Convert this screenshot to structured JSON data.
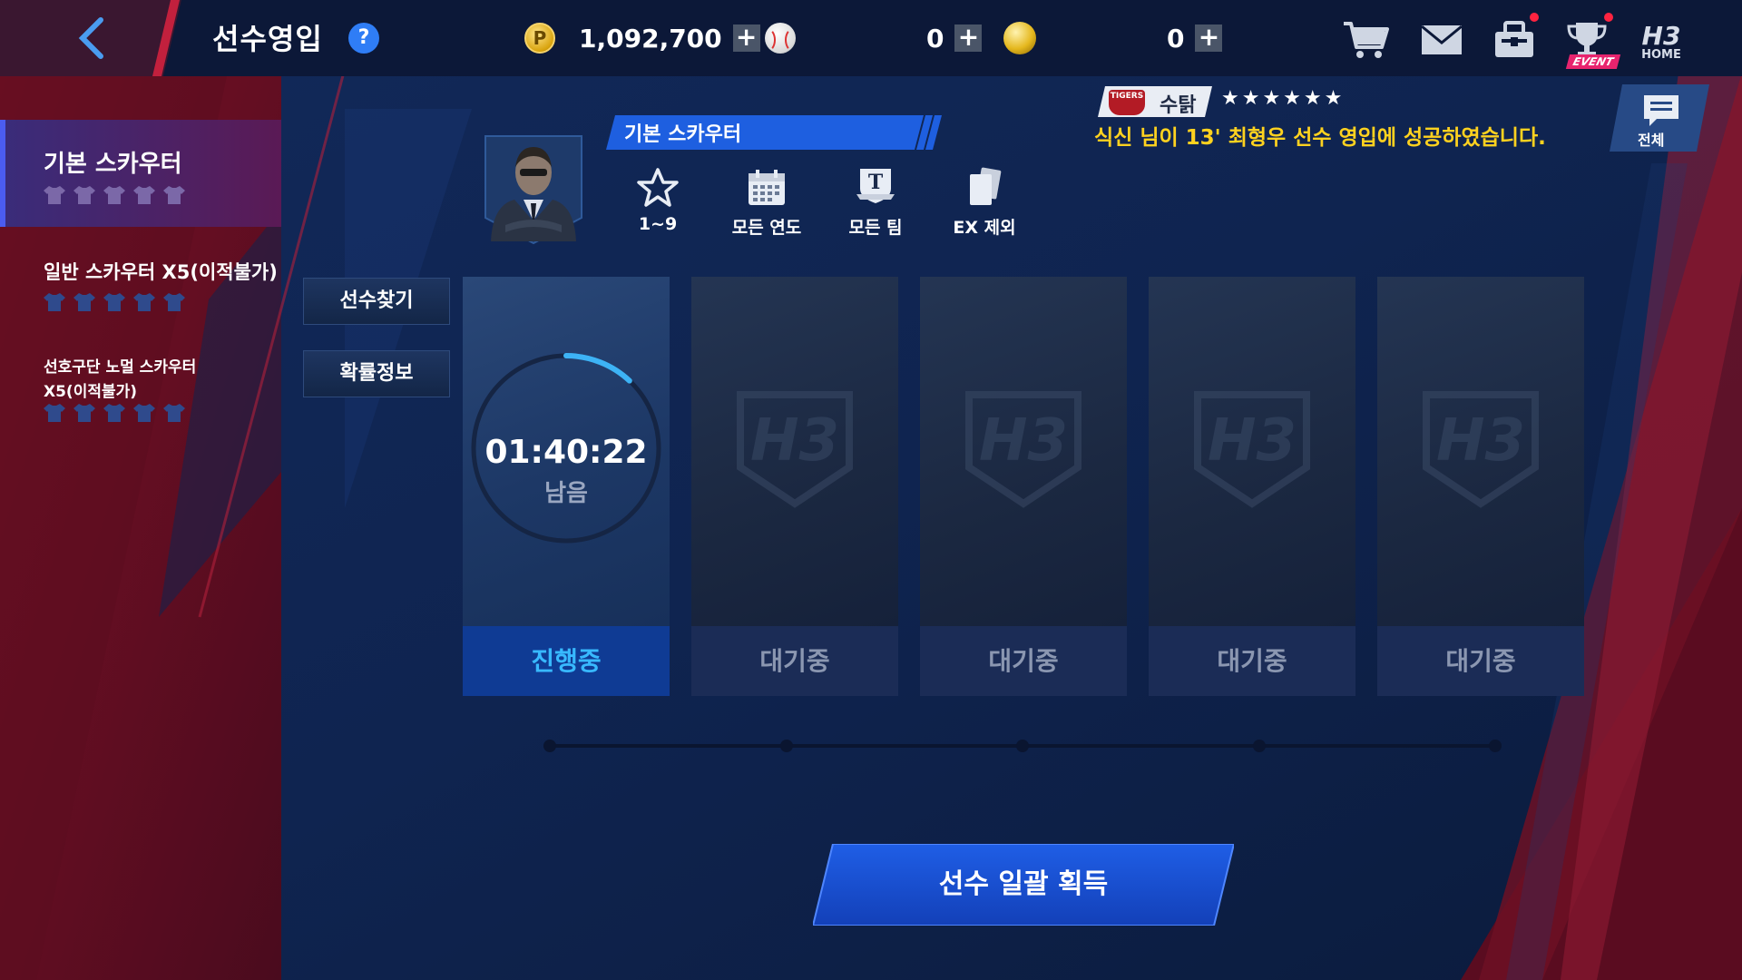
{
  "header": {
    "title": "선수영입",
    "help_icon": "question-mark-icon",
    "currencies": [
      {
        "icon": "p-coin-icon",
        "value": "1,092,700"
      },
      {
        "icon": "baseball-icon",
        "value": "0"
      },
      {
        "icon": "gold-ball-icon",
        "value": "0"
      }
    ],
    "icons": [
      "cart-icon",
      "mail-icon",
      "inventory-icon",
      "event-trophy-icon",
      "home-icon"
    ],
    "event_label": "EVENT",
    "home_label": "HOME"
  },
  "sidebar": {
    "items": [
      {
        "label": "기본 스카우터",
        "selected": true
      },
      {
        "label": "일반 스카우터 X5(이적불가)",
        "selected": false
      },
      {
        "label_line1": "선호구단 노멀 스카우터",
        "label_line2": "X5(이적불가)",
        "selected": false
      }
    ]
  },
  "scouter": {
    "name": "기본 스카우터",
    "filters": [
      {
        "icon": "star-icon",
        "label": "1~9"
      },
      {
        "icon": "calendar-icon",
        "label": "모든 연도"
      },
      {
        "icon": "team-icon",
        "label": "모든 팀"
      },
      {
        "icon": "cards-icon",
        "label": "EX 제외"
      }
    ]
  },
  "notice": {
    "team_logo_text": "TIGERS",
    "player_name": "수탉",
    "stars": "★★★★★★",
    "message": "식신 님이 13' 최형우 선수 영입에 성공하였습니다.",
    "all_label": "전체"
  },
  "actions": {
    "find_player": "선수찾기",
    "probability_info": "확률정보",
    "acquire_all": "선수 일괄 획득"
  },
  "slots": [
    {
      "status": "진행중",
      "timer": "01:40:22",
      "timer_sub": "남음",
      "progress": 0.12
    },
    {
      "status": "대기중"
    },
    {
      "status": "대기중"
    },
    {
      "status": "대기중"
    },
    {
      "status": "대기중"
    }
  ],
  "colors": {
    "background": "#0d1f45",
    "accent_blue": "#1e5fe0",
    "active_text": "#38b9ff",
    "notice_yellow": "#ffd21f",
    "side_red": "#8a1426"
  }
}
